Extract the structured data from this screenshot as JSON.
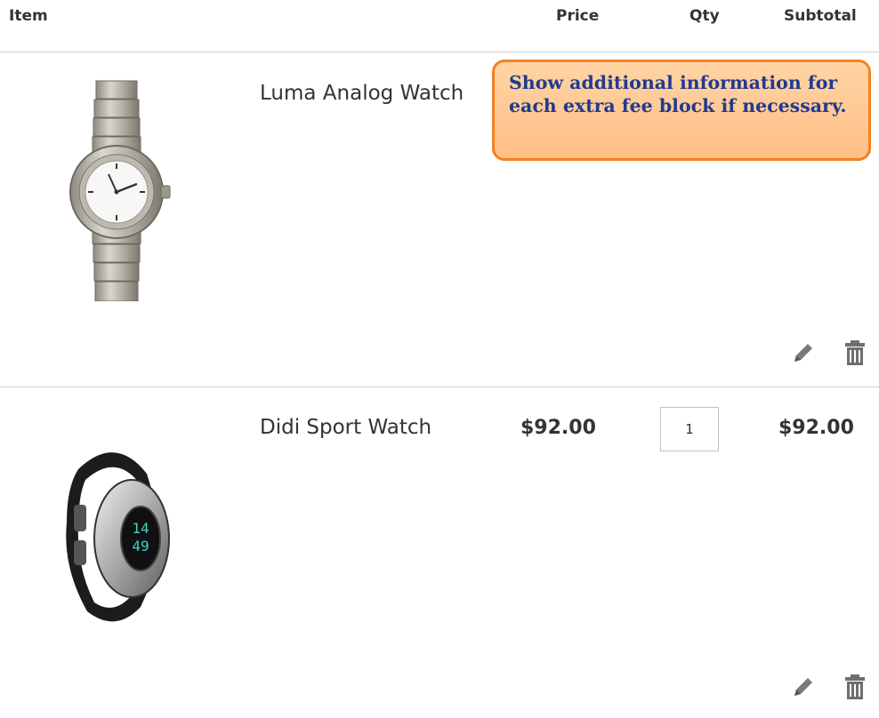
{
  "table_header": {
    "item": "Item",
    "price": "Price",
    "qty": "Qty",
    "subtotal": "Subtotal"
  },
  "items": [
    {
      "name": "Luma Analog Watch",
      "image": "luma-analog-watch-image",
      "price": "",
      "qty": "",
      "subtotal": ""
    },
    {
      "name": "Didi Sport Watch",
      "image": "didi-sport-watch-image",
      "price": "$92.00",
      "qty": "1",
      "subtotal": "$92.00"
    }
  ],
  "actions": {
    "edit_icon": "pencil-icon",
    "delete_icon": "trash-icon"
  },
  "tooltip": {
    "text": "Show additional information for each extra fee block if necessary.",
    "background": "#ffc892",
    "border": "#f38222",
    "text_color": "#223a8e"
  }
}
